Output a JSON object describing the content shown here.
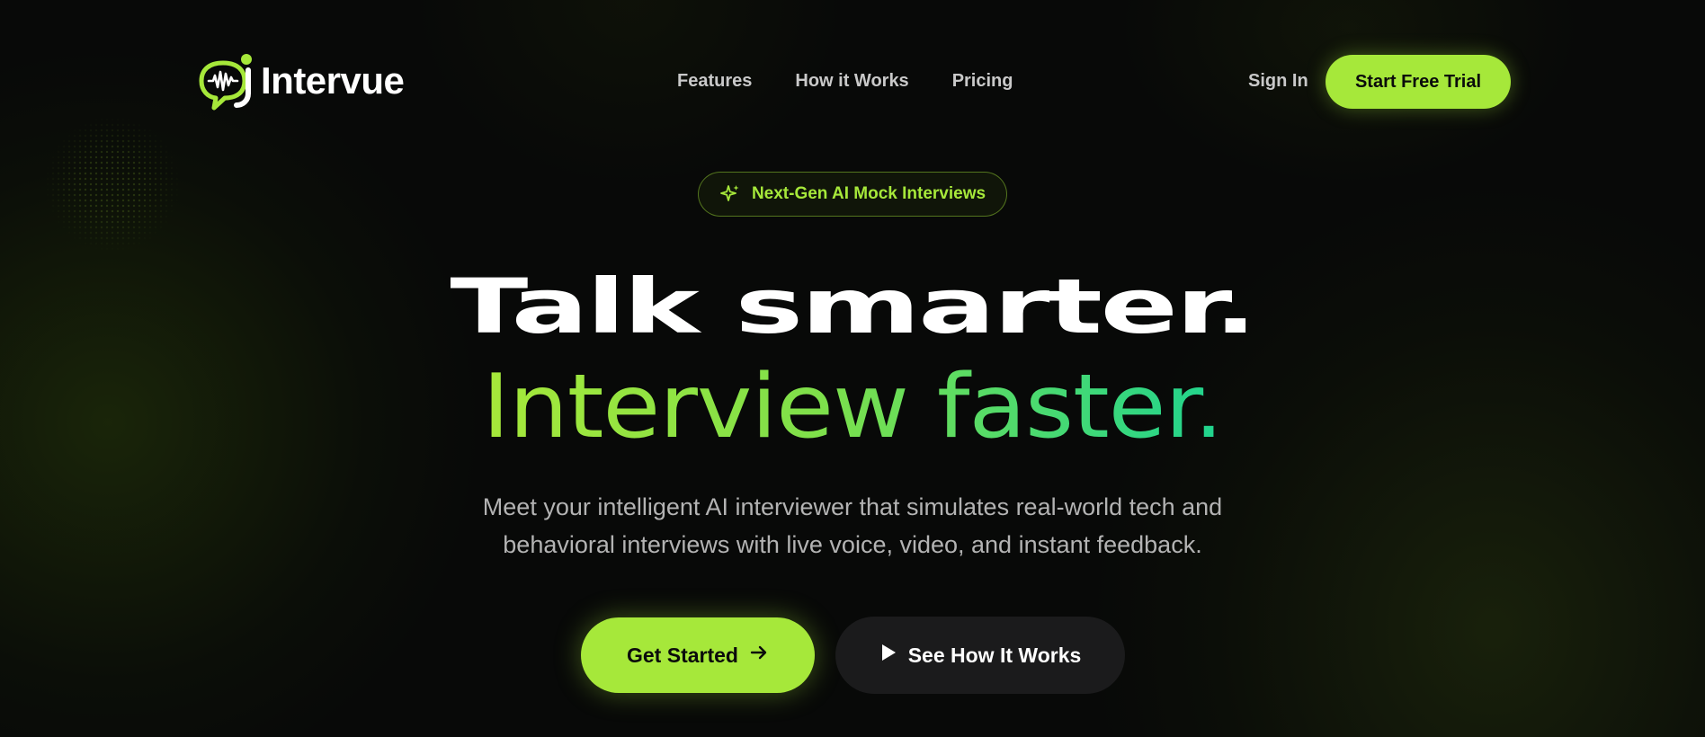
{
  "brand": {
    "name": "Intervue",
    "accent_color": "#a6e83a",
    "gradient_end_color": "#1fd48f"
  },
  "nav": {
    "items": [
      {
        "label": "Features"
      },
      {
        "label": "How it Works"
      },
      {
        "label": "Pricing"
      }
    ],
    "sign_in": "Sign In",
    "cta": "Start Free Trial"
  },
  "hero": {
    "badge": {
      "icon": "sparkle-icon",
      "text": "Next-Gen AI Mock Interviews"
    },
    "headline_line1": "Talk smarter.",
    "headline_line2": "Interview faster.",
    "subtitle_line1": "Meet your intelligent AI interviewer that simulates real-world tech and",
    "subtitle_line2": "behavioral interviews with live voice, video, and instant feedback.",
    "primary_button": {
      "label": "Get Started",
      "icon": "arrow-right-icon"
    },
    "secondary_button": {
      "label": "See How It Works",
      "icon": "play-icon"
    }
  }
}
